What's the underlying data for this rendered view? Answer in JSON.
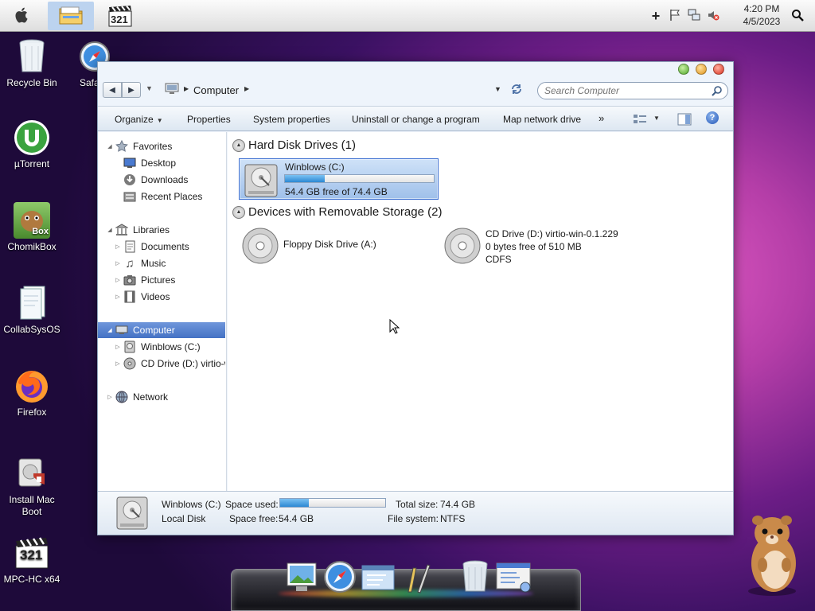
{
  "menubar": {
    "clock_time": "4:20 PM",
    "clock_date": "4/5/2023",
    "taskbar_mpc_badge": "321"
  },
  "desktop_icons": [
    {
      "label": "Recycle Bin"
    },
    {
      "label": "Safa"
    },
    {
      "label": "µTorrent"
    },
    {
      "label": "ChomikBox",
      "badge": "Box"
    },
    {
      "label": "CollabSysOS"
    },
    {
      "label": "Firefox"
    },
    {
      "label": "Install Mac Boot"
    },
    {
      "label": "MPC-HC x64",
      "badge": "321"
    }
  ],
  "window": {
    "address": {
      "crumb": "Computer"
    },
    "search": {
      "placeholder": "Search Computer"
    },
    "toolbar": {
      "organize": "Organize",
      "properties": "Properties",
      "system_properties": "System properties",
      "uninstall": "Uninstall or change a program",
      "map_drive": "Map network drive",
      "more": "»",
      "help": "?"
    },
    "nav": {
      "favorites": "Favorites",
      "desktop": "Desktop",
      "downloads": "Downloads",
      "recent_places": "Recent Places",
      "libraries": "Libraries",
      "documents": "Documents",
      "music": "Music",
      "pictures": "Pictures",
      "videos": "Videos",
      "computer": "Computer",
      "drive_c": "Winblows (C:)",
      "drive_d": "CD Drive (D:) virtio-w",
      "network": "Network"
    },
    "content": {
      "group_hdd": "Hard Disk Drives (1)",
      "group_removable": "Devices with Removable Storage (2)",
      "drive_c": {
        "name": "Winblows (C:)",
        "free_text": "54.4 GB free of 74.4 GB",
        "used_fraction": 0.27
      },
      "floppy": {
        "name": "Floppy Disk Drive (A:)"
      },
      "cd": {
        "name": "CD Drive (D:) virtio-win-0.1.229",
        "free_text": "0 bytes free of 510 MB",
        "fs": "CDFS"
      }
    },
    "status": {
      "drive_name": "Winblows (C:)",
      "drive_type": "Local Disk",
      "space_used_label": "Space used:",
      "space_used_fraction": 0.27,
      "space_free_label": "Space free:",
      "space_free_value": "54.4 GB",
      "total_size_label": "Total size:",
      "total_size_value": "74.4 GB",
      "file_system_label": "File system:",
      "file_system_value": "NTFS"
    }
  },
  "colors": {
    "selection": "#4472c4",
    "progress_fill": "#2b88d3",
    "desktop_bg": "#6c1d86"
  }
}
